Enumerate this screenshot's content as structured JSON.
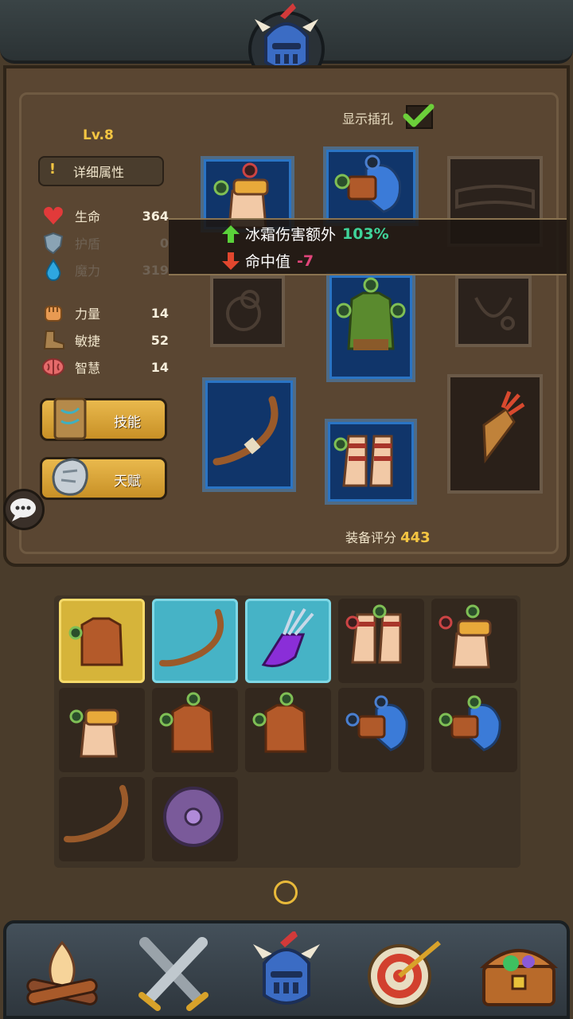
{
  "header": {
    "helmet_icon": "knight-helmet-icon"
  },
  "hero": {
    "level": "Lv.8",
    "detail_button": "详细属性",
    "stats": [
      {
        "name": "生命",
        "value": "364",
        "icon": "heart-icon",
        "color": "#e23a3a"
      },
      {
        "name": "护盾",
        "value": "0",
        "icon": "shield-icon",
        "color": "#9ab3c4"
      },
      {
        "name": "魔力",
        "value": "319",
        "icon": "mana-drop-icon",
        "color": "#2ea7e0"
      },
      {
        "name": "力量",
        "value": "14",
        "icon": "fist-icon",
        "color": "#e89a52"
      },
      {
        "name": "敏捷",
        "value": "52",
        "icon": "boot-icon",
        "color": "#a9824e"
      },
      {
        "name": "智慧",
        "value": "14",
        "icon": "brain-icon",
        "color": "#e56a6a"
      }
    ],
    "skill_button": "技能",
    "talent_button": "天赋"
  },
  "equipment": {
    "show_slots_label": "显示插孔",
    "show_slots_checked": true,
    "score_label": "装备评分",
    "score_value": "443"
  },
  "tooltip": {
    "line1_label": "冰霜伤害额外",
    "line1_value": "103%",
    "line1_color": "#3fd39a",
    "line2_label": "命中值",
    "line2_value": "-7",
    "line2_color": "#e0457a"
  },
  "bottom_nav": [
    "campfire-icon",
    "crossed-swords-icon",
    "knight-helmet-icon",
    "archery-target-icon",
    "treasure-chest-icon"
  ]
}
